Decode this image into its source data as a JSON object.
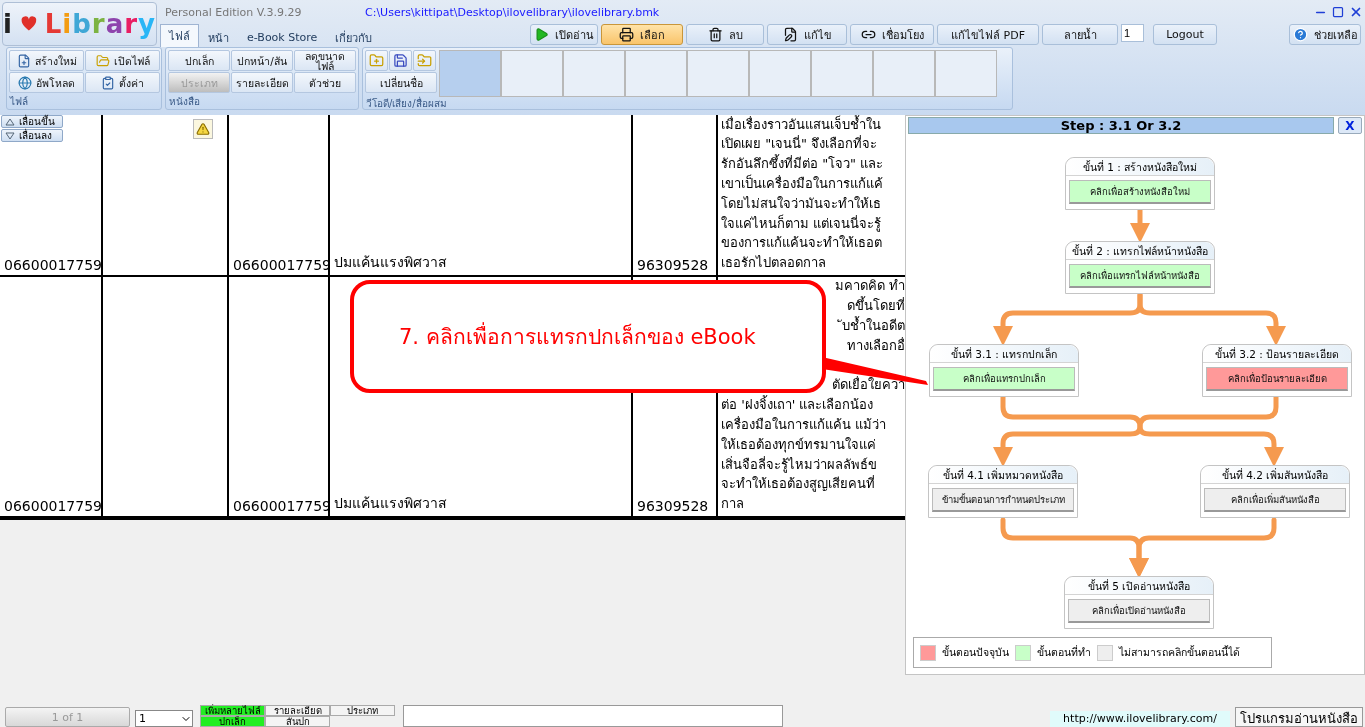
{
  "window": {
    "edition": "Personal Edition V.3.9.29",
    "path": "C:\\Users\\kittipat\\Desktop\\ilovelibrary\\ilovelibrary.bmk"
  },
  "logo": {
    "prefix": "i",
    "name": "Library"
  },
  "tabs": [
    {
      "label": "ไฟล์",
      "selected": true
    },
    {
      "label": "หน้า",
      "selected": false
    },
    {
      "label": "e-Book Store",
      "selected": false
    },
    {
      "label": "เกี่ยวกับ",
      "selected": false
    }
  ],
  "toolbar": {
    "buttons": [
      {
        "label": "เปิดอ่าน",
        "selected": false
      },
      {
        "label": "เลือก",
        "selected": true
      },
      {
        "label": "ลบ",
        "selected": false
      },
      {
        "label": "แก้ไข",
        "selected": false
      },
      {
        "label": "เชื่อมโยง",
        "selected": false
      },
      {
        "label": "แก้ไขไฟล์ PDF",
        "selected": false
      },
      {
        "label": "ลายน้ำ",
        "selected": false
      }
    ],
    "page_field": {
      "value": "1"
    },
    "logout": "Logout",
    "help": "ช่วยเหลือ"
  },
  "ribbon": {
    "file_group": {
      "title": "ไฟล์",
      "buttons": [
        {
          "label": "สร้างใหม่"
        },
        {
          "label": "เปิดไฟล์"
        },
        {
          "label": "อัพโหลด"
        },
        {
          "label": "ตั้งค่า"
        }
      ]
    },
    "book_group": {
      "title": "หนังสือ",
      "buttons": [
        {
          "label": "ปกเล็ก",
          "disabled": false
        },
        {
          "label": "ปกหน้า/สัน",
          "disabled": false
        },
        {
          "label": "ลดขนาดไฟล์",
          "disabled": false
        },
        {
          "label": "ประเภท",
          "disabled": true
        },
        {
          "label": "รายละเอียด",
          "disabled": false
        },
        {
          "label": "ตัวช่วย",
          "disabled": false
        }
      ]
    },
    "media_group": {
      "title": "วีโอดี/เสียง/สื่อผสม",
      "rename": "เปลี่ยนชื่อ",
      "thumbnails": [
        {
          "selected": true
        },
        {
          "selected": false
        },
        {
          "selected": false
        },
        {
          "selected": false
        },
        {
          "selected": false
        },
        {
          "selected": false
        },
        {
          "selected": false
        },
        {
          "selected": false
        },
        {
          "selected": false
        }
      ]
    }
  },
  "scroll": {
    "up": "เลื่อนขึ้น",
    "down": "เลื่อนลง"
  },
  "table": {
    "rows": [
      {
        "column_1": "06600017759",
        "flagged": true,
        "column_3": "06600017759",
        "column_4": "ปมแค้นแรงพิศวาส",
        "column_5": "96309528",
        "description": {
          "lines": [
            "เมื่อเรื่องราวอันแสนเจ็บช้ำใน",
            "เปิดเผย \"เจนนี่\" จึงเลือกที่จะ",
            "รักอันลึกซึ้งที่มีต่อ \"โจว\" และ",
            "เขาเป็นเครื่องมือในการแก้แค้",
            "โดยไม่สนใจว่ามันจะทำให้เธ",
            "ใจแค่ไหนก็ตาม แต่เจนนี่จะรู้",
            "ของการแก้แค้นจะทำให้เธอต",
            "เธอรักไปตลอดกาล"
          ]
        }
      },
      {
        "column_1": "06600017759",
        "flagged": false,
        "column_3": "06600017759",
        "column_4": "ปมแค้นแรงพิศวาส",
        "column_5": "96309528",
        "description": {
          "covered": [
            "มคาดคิด ทำ",
            "ดขึ้นโดยที่",
            "ับช้ำในอดีต",
            "ทางเลือกอื่"
          ],
          "covered_below": [
            "ตัดเยื่อใยควา"
          ],
          "lines": [
            "ต่อ 'ฝงจิ้งเถา' และเลือกน้อง",
            "เครื่องมือในการแก้แค้น แม้ว่า",
            "ให้เธอต้องทุกข์ทรมานใจแค่",
            "เสิ่นจือลี่จะรู้ไหมว่าผลลัพธ์ข",
            "จะทำให้เธอต้องสูญเสียคนที่",
            "กาล"
          ]
        }
      }
    ]
  },
  "callout": {
    "text": "7. คลิกเพื่อการแทรกปกเล็กของ eBook"
  },
  "panel": {
    "title": "Step : 3.1 Or 3.2",
    "close": "X",
    "nodes": [
      {
        "header": "ขั้นที่ 1 : สร้างหนังสือใหม่",
        "action": "คลิกเพื่อสร้างหนังสือใหม่",
        "current": false,
        "disabled": false
      },
      {
        "header": "ขั้นที่ 2 : แทรกไฟล์หน้าหนังสือ",
        "action": "คลิกเพื่อแทรกไฟล์หน้าหนังสือ",
        "current": false,
        "disabled": false
      },
      {
        "header": "ขั้นที่ 3.1 : แทรกปกเล็ก",
        "action": "คลิกเพื่อแทรกปกเล็ก",
        "current": false,
        "disabled": false
      },
      {
        "header": "ขั้นที่ 3.2 : ป้อนรายละเอียด",
        "action": "คลิกเพื่อป้อนรายละเอียด",
        "current": true,
        "disabled": false
      },
      {
        "header": "ขั้นที่ 4.1 เพิ่มหมวดหนังสือ",
        "action": "ข้ามขั้นตอนการกำหนดประเภท",
        "current": false,
        "disabled": true
      },
      {
        "header": "ขั้นที่ 4.2 เพิ่มสันหนังสือ",
        "action": "คลิกเพื่อเพิ่มสันหนังสือ",
        "current": false,
        "disabled": true
      },
      {
        "header": "ขั้นที่ 5 เปิดอ่านหนังสือ",
        "action": "คลิกเพื่อเปิดอ่านหนังสือ",
        "current": false,
        "disabled": true
      }
    ],
    "legend": [
      {
        "color": "#ff9999",
        "label": "ขั้นตอนปัจจุบัน"
      },
      {
        "color": "#c8ffc8",
        "label": "ขั้นตอนที่ทำ"
      },
      {
        "color": "#eeeeee",
        "label": "ไม่สามารถคลิกขั้นตอนนี้ได้"
      }
    ]
  },
  "status_bar": {
    "pager": "1 of 1",
    "page_select": "1",
    "buttons": [
      {
        "label": "เพิ่มหลายไฟล์",
        "on": true
      },
      {
        "label": "รายละเอียด",
        "on": false
      },
      {
        "label": "ประเภท",
        "on": false
      },
      {
        "label": "ปกเล็ก",
        "on": true
      },
      {
        "label": "สันปก",
        "on": false
      }
    ],
    "url": "http://www.ilovelibrary.com/",
    "reader": "โปรแกรมอ่านหนังสือ"
  }
}
